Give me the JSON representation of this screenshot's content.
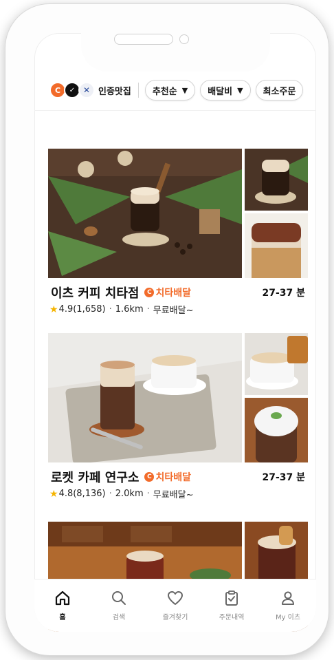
{
  "filters": {
    "verified_label": "인증맛집",
    "chips": [
      {
        "label": "추천순"
      },
      {
        "label": "배달비"
      },
      {
        "label": "최소주문"
      }
    ]
  },
  "stores": [
    {
      "name": "이츠 커피 치타점",
      "badge": "치타배달",
      "eta": "27-37 분",
      "rating": "4.9(1,658)",
      "distance": "1.6km",
      "delivery_fee": "무료배달~"
    },
    {
      "name": "로켓 카페 연구소",
      "badge": "치타배달",
      "eta": "27-37 분",
      "rating": "4.8(8,136)",
      "distance": "2.0km",
      "delivery_fee": "무료배달~"
    }
  ],
  "tabs": [
    {
      "label": "홈",
      "icon": "home-icon",
      "active": true
    },
    {
      "label": "검색",
      "icon": "search-icon",
      "active": false
    },
    {
      "label": "즐겨찾기",
      "icon": "heart-icon",
      "active": false
    },
    {
      "label": "주문내역",
      "icon": "clipboard-icon",
      "active": false
    },
    {
      "label": "My 이츠",
      "icon": "person-icon",
      "active": false
    }
  ],
  "colors": {
    "accent": "#f26b2a",
    "rating_star": "#f5b400"
  }
}
